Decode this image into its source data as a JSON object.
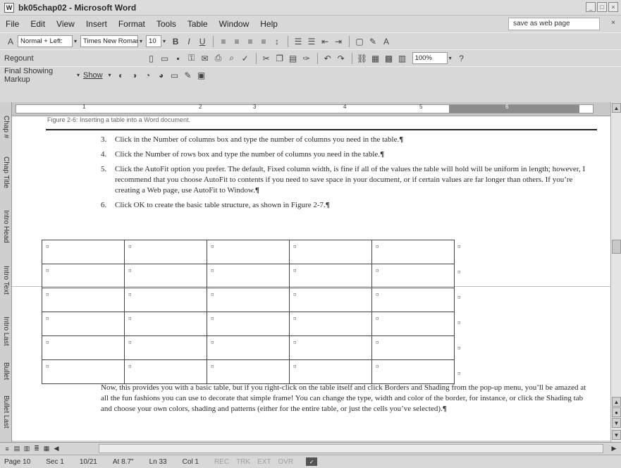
{
  "window": {
    "title": "bk05chap02 - Microsoft Word",
    "app_icon": "word-icon"
  },
  "menu": [
    "File",
    "Edit",
    "View",
    "Insert",
    "Format",
    "Tools",
    "Table",
    "Window",
    "Help"
  ],
  "help_box": "save as web page",
  "formatting_toolbar": {
    "style": "Normal + Left:",
    "font": "Times New Roman",
    "size": "10",
    "bold": "B",
    "italic": "I",
    "underline": "U"
  },
  "standard_toolbar": {
    "label": "Regount",
    "zoom": "100%"
  },
  "reviewing_toolbar": {
    "mode": "Final Showing Markup",
    "show": "Show"
  },
  "side_tabs": [
    "Chap #",
    "Chap Title",
    "Intro Head",
    "Intro Text",
    "Intro Last",
    "Bullet",
    "Bullet Last"
  ],
  "ruler_numbers": [
    "1",
    "2",
    "3",
    "4",
    "5",
    "6"
  ],
  "document": {
    "caption": "Figure 2-6: Inserting a table into a Word document.",
    "steps": [
      {
        "num": "3.",
        "text": "Click in the Number of columns box and type the number of columns you need in the table."
      },
      {
        "num": "4.",
        "text": "Click the Number of rows box and type the number of columns you need in the table."
      },
      {
        "num": "5.",
        "text": "Click the AutoFit option you prefer. The default, Fixed column width, is fine if all of the values the table will hold will be uniform in length; however, I recommend that you choose AutoFit to contents if you need to save space in your document, or if certain values are far longer than others. If you’re creating a Web page, use AutoFit to Window."
      },
      {
        "num": "6.",
        "text": "Click OK to create the basic table structure, as shown in Figure 2-7."
      }
    ],
    "pilcrow": "¶",
    "cell_mark": "¤",
    "paragraph": "Now, this provides you with a basic table, but if you right-click on the table itself and click Borders and Shading from the pop-up menu, you’ll be amazed at all the fun fashions you can use to decorate that simple frame! You can change the type, width and color of the border, for instance, or click the Shading tab and choose your own colors, shading and patterns (either for the entire table, or just the cells you’ve selected).",
    "table": {
      "rows": 6,
      "cols": 5
    }
  },
  "status": {
    "page": "Page 10",
    "sec": "Sec 1",
    "pages": "10/21",
    "at": "At 8.7\"",
    "ln": "Ln 33",
    "col": "Col 1",
    "rec": "REC",
    "trk": "TRK",
    "ext": "EXT",
    "ovr": "OVR"
  }
}
